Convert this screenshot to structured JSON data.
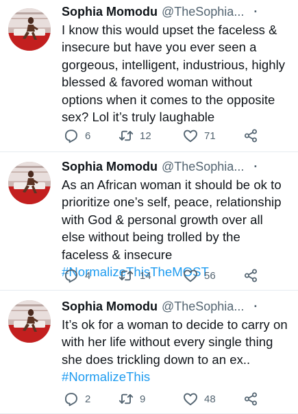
{
  "tweets": [
    {
      "author": "Sophia Momodu",
      "handle": "@TheSophia...",
      "dot": "·",
      "text": "I know this would upset the faceless & insecure but have you ever seen a gorgeous, intelligent, industrious, highly blessed & favored woman without options when it comes to the opposite sex? Lol it’s truly laughable",
      "hashtag": "",
      "replies": "6",
      "retweets": "12",
      "likes": "71"
    },
    {
      "author": "Sophia Momodu",
      "handle": "@TheSophia...",
      "dot": "·",
      "text": "As an African woman it should be ok to prioritize one’s self, peace, relationship with God & personal growth over all else without being trolled by the faceless & insecure ",
      "hashtag": "#NormalizeThisTheMOST",
      "replies": "4",
      "retweets": "14",
      "likes": "56"
    },
    {
      "author": "Sophia Momodu",
      "handle": "@TheSophia...",
      "dot": "·",
      "text": "It’s ok for a woman to decide to carry on with her life without every single thing she does trickling down to an ex.. ",
      "hashtag": "#NormalizeThis",
      "replies": "2",
      "retweets": "9",
      "likes": "48"
    }
  ],
  "icons": {
    "reply": "reply-icon",
    "retweet": "retweet-icon",
    "like": "heart-icon",
    "share": "share-icon",
    "avatar": "profile-photo"
  },
  "colors": {
    "text": "#0f1419",
    "muted": "#536471",
    "link": "#1d9bf0",
    "divider": "#e6ecf0"
  }
}
